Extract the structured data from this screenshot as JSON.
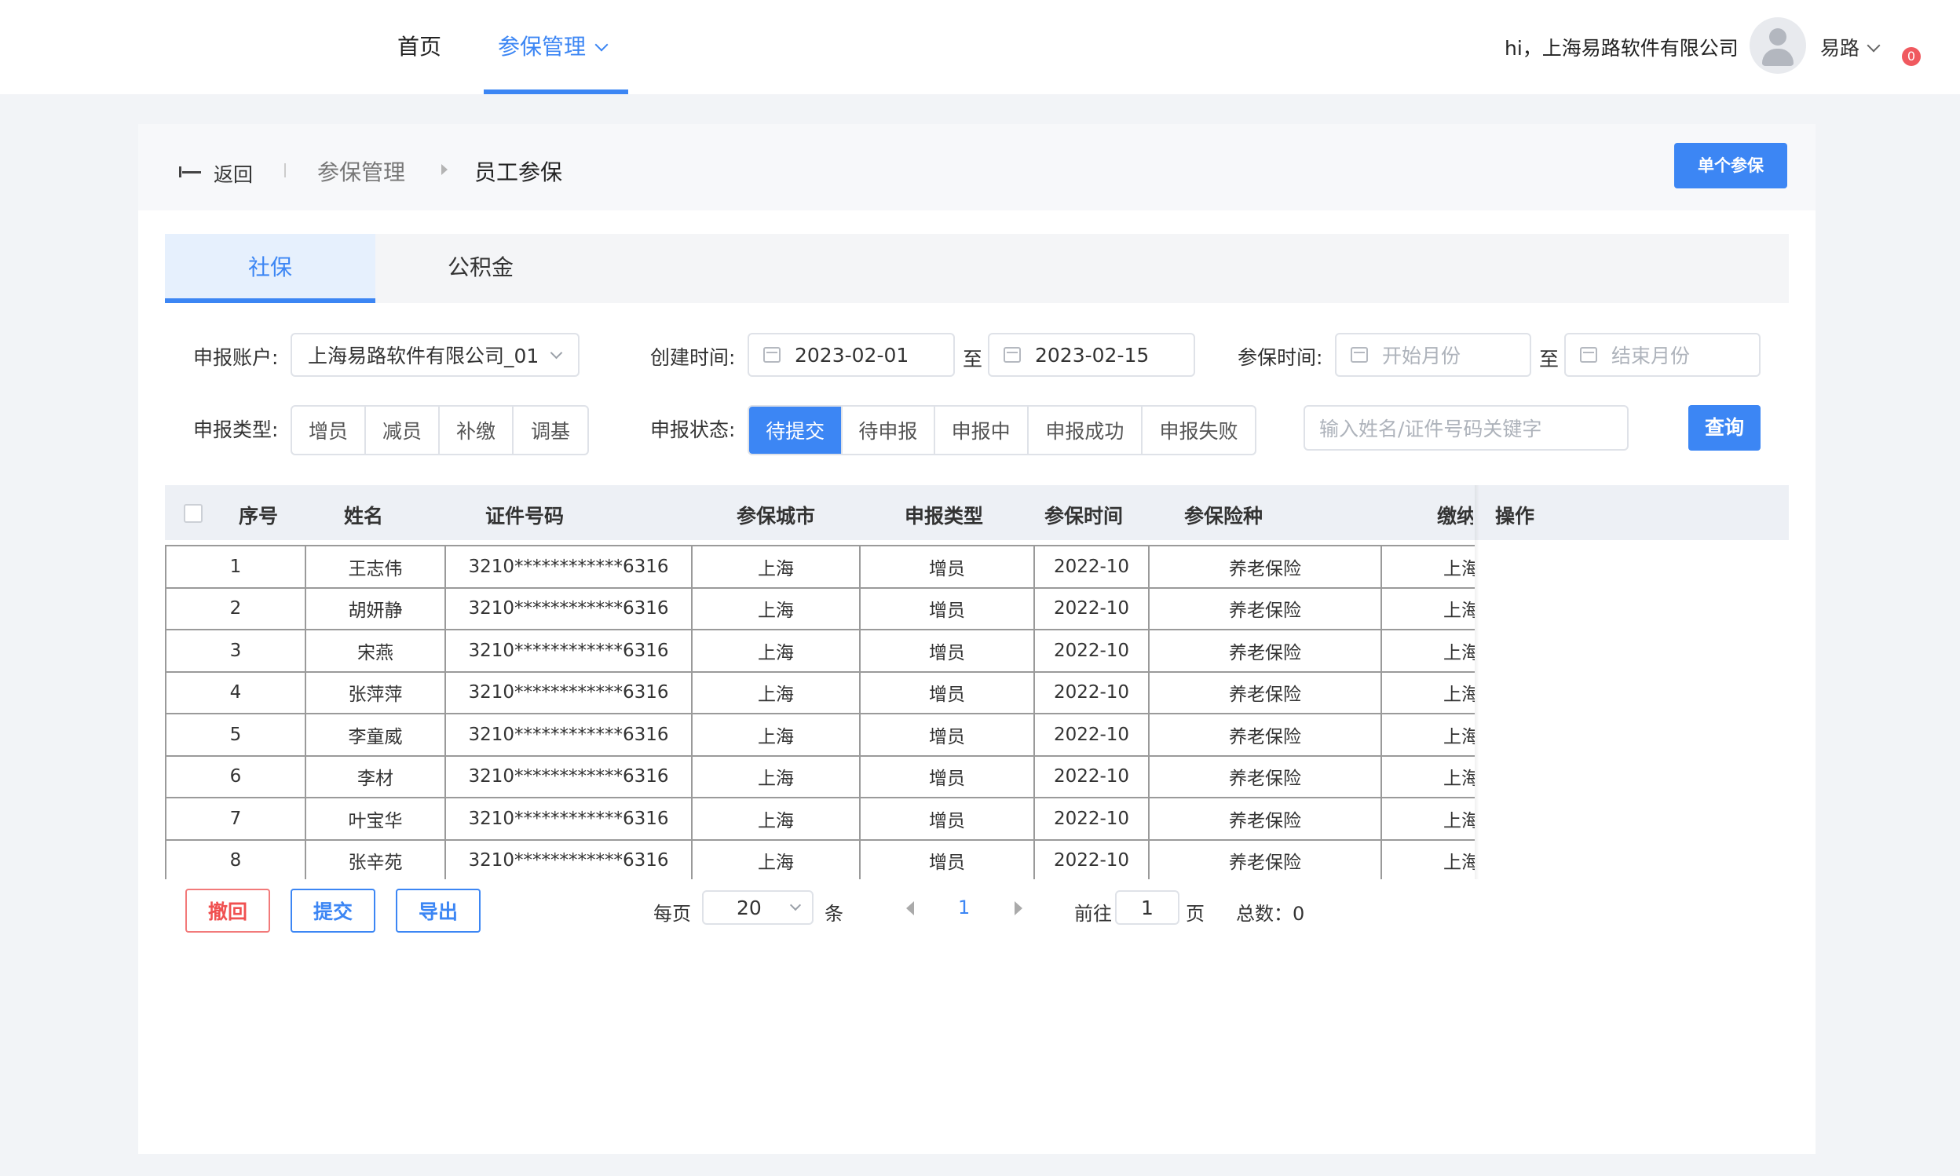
{
  "nav": {
    "home": "首页",
    "insurance_mgmt": "参保管理"
  },
  "user": {
    "greeting": "hi，上海易路软件有限公司",
    "name": "易路",
    "notification_count": "0"
  },
  "breadcrumb": {
    "back": "返回",
    "parent": "参保管理",
    "current": "员工参保"
  },
  "actions": {
    "single_enroll": "单个参保"
  },
  "tabs": [
    {
      "label": "社保"
    },
    {
      "label": "公积金"
    }
  ],
  "filters": {
    "account_label": "申报账户:",
    "account_value": "上海易路软件有限公司_01",
    "created_label": "创建时间:",
    "created_start": "2023-02-01",
    "created_end": "2023-02-15",
    "to": "至",
    "enroll_label": "参保时间:",
    "enroll_start_placeholder": "开始月份",
    "enroll_end_placeholder": "结束月份",
    "type_label": "申报类型:",
    "types": [
      "增员",
      "减员",
      "补缴",
      "调基"
    ],
    "status_label": "申报状态:",
    "statuses": [
      "待提交",
      "待申报",
      "申报中",
      "申报成功",
      "申报失败"
    ],
    "search_placeholder": "输入姓名/证件号码关键字",
    "query": "查询"
  },
  "table": {
    "headers": [
      "序号",
      "姓名",
      "证件号码",
      "参保城市",
      "申报类型",
      "参保时间",
      "参保险种",
      "缴纳",
      "操作"
    ],
    "rows": [
      [
        "1",
        "王志伟",
        "3210************6316",
        "上海",
        "增员",
        "2022-10",
        "养老保险",
        "上海易路"
      ],
      [
        "2",
        "胡妍静",
        "3210************6316",
        "上海",
        "增员",
        "2022-10",
        "养老保险",
        "上海易路"
      ],
      [
        "3",
        "宋燕",
        "3210************6316",
        "上海",
        "增员",
        "2022-10",
        "养老保险",
        "上海易路"
      ],
      [
        "4",
        "张萍萍",
        "3210************6316",
        "上海",
        "增员",
        "2022-10",
        "养老保险",
        "上海易路"
      ],
      [
        "5",
        "李童威",
        "3210************6316",
        "上海",
        "增员",
        "2022-10",
        "养老保险",
        "上海易路"
      ],
      [
        "6",
        "李材",
        "3210************6316",
        "上海",
        "增员",
        "2022-10",
        "养老保险",
        "上海易路"
      ],
      [
        "7",
        "叶宝华",
        "3210************6316",
        "上海",
        "增员",
        "2022-10",
        "养老保险",
        "上海易路"
      ],
      [
        "8",
        "张辛苑",
        "3210************6316",
        "上海",
        "增员",
        "2022-10",
        "养老保险",
        "上海易路"
      ]
    ]
  },
  "bottom_actions": {
    "withdraw": "撤回",
    "submit": "提交",
    "export": "导出"
  },
  "pagination": {
    "per_page_label": "每页",
    "per_page_value": "20",
    "per_page_unit": "条",
    "current_page": "1",
    "goto_label": "前往",
    "goto_value": "1",
    "goto_unit": "页",
    "total": "总数：0"
  },
  "colors": {
    "accent": "#3c86f4",
    "danger": "#f05050",
    "badge": "#f0595f"
  }
}
